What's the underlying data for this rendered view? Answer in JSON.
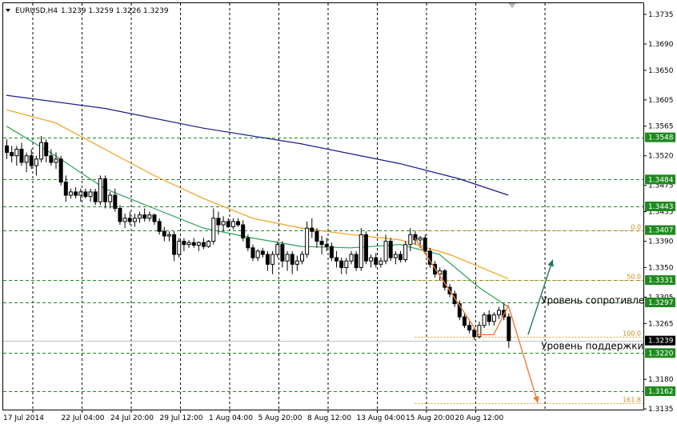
{
  "header": {
    "symbol": "EURUSD,H4",
    "ohlc": "1.3239 1.3259 1.3226 1.3239"
  },
  "colors": {
    "bull": "#ffffff",
    "bear": "#000000",
    "wick": "#000000",
    "ma_slow": "#1a1a8c",
    "ma_mid": "#f0a020",
    "ma_fast": "#2e9e5a",
    "level_line": "#1f8a1f",
    "fib": "#e8a030",
    "arrow_down": "#f07a3a",
    "arrow_up": "#1e7a5a",
    "grid": "#000000",
    "current_price_bg": "#000000"
  },
  "chart_data": {
    "type": "candlestick",
    "ylim": [
      1.3134,
      1.3752
    ],
    "y_ticks": [
      "1.3735",
      "1.3690",
      "1.3650",
      "1.3605",
      "1.3565",
      "1.3520",
      "1.3475",
      "1.3435",
      "1.3390",
      "1.3350",
      "1.3305",
      "1.3265",
      "1.3180",
      "1.3135"
    ],
    "x_labels": [
      "17 Jul 2014",
      "22 Jul 04:00",
      "24 Jul 20:00",
      "29 Jul 12:00",
      "1 Aug 04:00",
      "5 Aug 20:00",
      "8 Aug 12:00",
      "13 Aug 04:00",
      "15 Aug 20:00",
      "20 Aug 12:00"
    ],
    "x_label_positions": [
      0,
      10,
      20,
      30,
      40,
      50,
      60,
      70,
      80,
      90
    ],
    "levels": [
      {
        "value": 1.3548,
        "label": "1.3548"
      },
      {
        "value": 1.3484,
        "label": "1.3484"
      },
      {
        "value": 1.3443,
        "label": "1.3443"
      },
      {
        "value": 1.3407,
        "label": "1.3407"
      },
      {
        "value": 1.3331,
        "label": "1.3331"
      },
      {
        "value": 1.3297,
        "label": "1.3297"
      },
      {
        "value": 1.322,
        "label": "1.3220"
      },
      {
        "value": 1.3162,
        "label": "1.3162"
      }
    ],
    "current_price": {
      "value": 1.3239,
      "label": "1.3239"
    },
    "fibonacci": [
      {
        "label": "0.0",
        "value": 1.3407
      },
      {
        "label": "50.0",
        "value": 1.3331
      },
      {
        "label": "100.0",
        "value": 1.3245
      },
      {
        "label": "161.8",
        "value": 1.3144
      }
    ],
    "candles": [
      [
        1.3535,
        1.3545,
        1.3515,
        1.3525
      ],
      [
        1.3525,
        1.3535,
        1.351,
        1.352
      ],
      [
        1.352,
        1.3535,
        1.3505,
        1.353
      ],
      [
        1.353,
        1.354,
        1.3505,
        1.351
      ],
      [
        1.351,
        1.3525,
        1.3495,
        1.352
      ],
      [
        1.352,
        1.353,
        1.35,
        1.3505
      ],
      [
        1.3505,
        1.352,
        1.349,
        1.3515
      ],
      [
        1.3515,
        1.355,
        1.351,
        1.354
      ],
      [
        1.354,
        1.3545,
        1.351,
        1.352
      ],
      [
        1.352,
        1.353,
        1.3505,
        1.351
      ],
      [
        1.351,
        1.3525,
        1.35,
        1.3515
      ],
      [
        1.3515,
        1.352,
        1.3475,
        1.348
      ],
      [
        1.348,
        1.349,
        1.345,
        1.346
      ],
      [
        1.346,
        1.347,
        1.3455,
        1.3465
      ],
      [
        1.3465,
        1.3472,
        1.3455,
        1.346
      ],
      [
        1.346,
        1.347,
        1.345,
        1.3465
      ],
      [
        1.3465,
        1.347,
        1.3455,
        1.3458
      ],
      [
        1.3458,
        1.347,
        1.345,
        1.3465
      ],
      [
        1.3465,
        1.347,
        1.3445,
        1.345
      ],
      [
        1.345,
        1.349,
        1.3445,
        1.3485
      ],
      [
        1.3485,
        1.349,
        1.344,
        1.345
      ],
      [
        1.345,
        1.3465,
        1.344,
        1.346
      ],
      [
        1.346,
        1.347,
        1.3435,
        1.344
      ],
      [
        1.344,
        1.3445,
        1.3415,
        1.342
      ],
      [
        1.342,
        1.3432,
        1.341,
        1.3425
      ],
      [
        1.3425,
        1.3435,
        1.3415,
        1.342
      ],
      [
        1.342,
        1.3432,
        1.3412,
        1.3425
      ],
      [
        1.3425,
        1.3435,
        1.3418,
        1.343
      ],
      [
        1.343,
        1.344,
        1.342,
        1.3425
      ],
      [
        1.3425,
        1.3435,
        1.342,
        1.343
      ],
      [
        1.343,
        1.3432,
        1.3415,
        1.342
      ],
      [
        1.342,
        1.3425,
        1.34,
        1.3405
      ],
      [
        1.3405,
        1.3412,
        1.339,
        1.3398
      ],
      [
        1.3398,
        1.3405,
        1.339,
        1.34
      ],
      [
        1.34,
        1.3405,
        1.336,
        1.337
      ],
      [
        1.337,
        1.3395,
        1.3365,
        1.339
      ],
      [
        1.339,
        1.3395,
        1.3375,
        1.3385
      ],
      [
        1.3385,
        1.3392,
        1.338,
        1.3388
      ],
      [
        1.3388,
        1.3395,
        1.338,
        1.3384
      ],
      [
        1.3384,
        1.339,
        1.3375,
        1.3388
      ],
      [
        1.3388,
        1.3395,
        1.3378,
        1.3382
      ],
      [
        1.3382,
        1.3392,
        1.338,
        1.339
      ],
      [
        1.339,
        1.344,
        1.3385,
        1.3425
      ],
      [
        1.3425,
        1.3435,
        1.34,
        1.3415
      ],
      [
        1.3415,
        1.3428,
        1.3405,
        1.342
      ],
      [
        1.342,
        1.3425,
        1.341,
        1.3412
      ],
      [
        1.3412,
        1.3425,
        1.3408,
        1.342
      ],
      [
        1.342,
        1.3425,
        1.3412,
        1.3415
      ],
      [
        1.3415,
        1.3422,
        1.339,
        1.3395
      ],
      [
        1.3395,
        1.34,
        1.3375,
        1.338
      ],
      [
        1.338,
        1.3385,
        1.336,
        1.3365
      ],
      [
        1.3365,
        1.3378,
        1.336,
        1.3375
      ],
      [
        1.3375,
        1.338,
        1.3365,
        1.337
      ],
      [
        1.337,
        1.3375,
        1.3345,
        1.3355
      ],
      [
        1.3355,
        1.3375,
        1.334,
        1.337
      ],
      [
        1.337,
        1.339,
        1.3365,
        1.3385
      ],
      [
        1.3385,
        1.339,
        1.335,
        1.336
      ],
      [
        1.336,
        1.3375,
        1.3345,
        1.337
      ],
      [
        1.337,
        1.3375,
        1.334,
        1.3355
      ],
      [
        1.3355,
        1.3368,
        1.3345,
        1.336
      ],
      [
        1.336,
        1.3375,
        1.3355,
        1.337
      ],
      [
        1.337,
        1.342,
        1.3365,
        1.341
      ],
      [
        1.341,
        1.3425,
        1.3395,
        1.3405
      ],
      [
        1.3405,
        1.341,
        1.338,
        1.339
      ],
      [
        1.339,
        1.3398,
        1.337,
        1.3385
      ],
      [
        1.3385,
        1.3395,
        1.3375,
        1.3382
      ],
      [
        1.3382,
        1.3388,
        1.336,
        1.3365
      ],
      [
        1.3365,
        1.3375,
        1.335,
        1.336
      ],
      [
        1.336,
        1.3365,
        1.334,
        1.335
      ],
      [
        1.335,
        1.3365,
        1.334,
        1.336
      ],
      [
        1.336,
        1.3375,
        1.3355,
        1.337
      ],
      [
        1.337,
        1.3375,
        1.3345,
        1.335
      ],
      [
        1.335,
        1.341,
        1.3345,
        1.34
      ],
      [
        1.34,
        1.3405,
        1.3355,
        1.336
      ],
      [
        1.336,
        1.337,
        1.335,
        1.3365
      ],
      [
        1.3365,
        1.3372,
        1.335,
        1.3355
      ],
      [
        1.3355,
        1.3365,
        1.335,
        1.336
      ],
      [
        1.336,
        1.34,
        1.3355,
        1.339
      ],
      [
        1.339,
        1.3395,
        1.336,
        1.3365
      ],
      [
        1.3365,
        1.3375,
        1.3355,
        1.337
      ],
      [
        1.337,
        1.3375,
        1.3358,
        1.3362
      ],
      [
        1.3362,
        1.339,
        1.3358,
        1.3385
      ],
      [
        1.3385,
        1.341,
        1.3375,
        1.34
      ],
      [
        1.34,
        1.3405,
        1.3385,
        1.3392
      ],
      [
        1.3392,
        1.3398,
        1.338,
        1.3395
      ],
      [
        1.3395,
        1.34,
        1.337,
        1.3375
      ],
      [
        1.3375,
        1.338,
        1.335,
        1.3355
      ],
      [
        1.3355,
        1.336,
        1.3335,
        1.334
      ],
      [
        1.334,
        1.335,
        1.333,
        1.3345
      ],
      [
        1.3345,
        1.3348,
        1.3315,
        1.332
      ],
      [
        1.332,
        1.3325,
        1.3305,
        1.331
      ],
      [
        1.331,
        1.3315,
        1.329,
        1.3295
      ],
      [
        1.3295,
        1.33,
        1.327,
        1.3275
      ],
      [
        1.3275,
        1.328,
        1.3258,
        1.3262
      ],
      [
        1.3262,
        1.3268,
        1.325,
        1.3255
      ],
      [
        1.3255,
        1.3258,
        1.324,
        1.3245
      ],
      [
        1.3245,
        1.3268,
        1.3242,
        1.3262
      ],
      [
        1.3262,
        1.3282,
        1.3258,
        1.3278
      ],
      [
        1.3278,
        1.3285,
        1.3262,
        1.3268
      ],
      [
        1.3268,
        1.3282,
        1.3262,
        1.3278
      ],
      [
        1.3278,
        1.329,
        1.3272,
        1.3285
      ],
      [
        1.3285,
        1.3295,
        1.327,
        1.3275
      ],
      [
        1.3275,
        1.328,
        1.3228,
        1.3239
      ]
    ],
    "ma_slow": [
      [
        0,
        1.3612
      ],
      [
        20,
        1.3592
      ],
      [
        40,
        1.3562
      ],
      [
        60,
        1.3538
      ],
      [
        80,
        1.3508
      ],
      [
        92,
        1.3485
      ],
      [
        102,
        1.346
      ]
    ],
    "ma_mid": [
      [
        0,
        1.359
      ],
      [
        10,
        1.357
      ],
      [
        20,
        1.353
      ],
      [
        30,
        1.349
      ],
      [
        40,
        1.3455
      ],
      [
        50,
        1.3425
      ],
      [
        60,
        1.341
      ],
      [
        70,
        1.34
      ],
      [
        80,
        1.3392
      ],
      [
        90,
        1.337
      ],
      [
        102,
        1.3333
      ]
    ],
    "ma_fast": [
      [
        0,
        1.3565
      ],
      [
        10,
        1.352
      ],
      [
        20,
        1.347
      ],
      [
        30,
        1.344
      ],
      [
        40,
        1.341
      ],
      [
        50,
        1.3395
      ],
      [
        60,
        1.3382
      ],
      [
        70,
        1.338
      ],
      [
        80,
        1.3385
      ],
      [
        88,
        1.337
      ],
      [
        96,
        1.332
      ],
      [
        102,
        1.329
      ]
    ],
    "arrow_down_path": [
      [
        83,
        1.3395
      ],
      [
        96,
        1.3248
      ],
      [
        99,
        1.3248
      ],
      [
        102,
        1.3292
      ],
      [
        108,
        1.3144
      ]
    ],
    "arrow_up_path": [
      [
        106,
        1.3248
      ],
      [
        111,
        1.3362
      ]
    ],
    "annotations": [
      {
        "text": "Уровень сопротивления",
        "bar": 108,
        "value": 1.33
      },
      {
        "text": "Уровень поддержки",
        "bar": 108,
        "value": 1.3231
      }
    ]
  }
}
